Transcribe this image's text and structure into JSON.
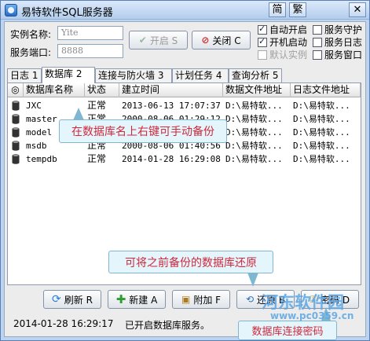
{
  "window": {
    "title": "易特软件SQL服务器",
    "btn_simplified": "简",
    "btn_traditional": "繁",
    "btn_close": "✕"
  },
  "form": {
    "instance_label": "实例名称:",
    "instance_value": "Yite",
    "port_label": "服务端口:",
    "port_value": "8888"
  },
  "buttons": {
    "start": "开启 S",
    "stop": "关闭 C"
  },
  "options": [
    {
      "label": "自动开启",
      "checked": true,
      "enabled": true
    },
    {
      "label": "服务守护",
      "checked": false,
      "enabled": true
    },
    {
      "label": "开机启动",
      "checked": true,
      "enabled": true
    },
    {
      "label": "服务日志",
      "checked": false,
      "enabled": true
    },
    {
      "label": "默认实例",
      "checked": false,
      "enabled": false
    },
    {
      "label": "服务窗口",
      "checked": false,
      "enabled": true
    }
  ],
  "tabs": [
    "日志 1",
    "数据库 2",
    "连接与防火墙 3",
    "计划任务 4",
    "查询分析 5"
  ],
  "active_tab": 1,
  "grid": {
    "headers": [
      "◎",
      "数据库名称",
      "状态",
      "建立时间",
      "数据文件地址",
      "日志文件地址"
    ],
    "rows": [
      {
        "name": "JXC",
        "status": "正常",
        "created": "2013-06-13 17:07:37",
        "data": "D:\\易特软...",
        "log": "D:\\易特软..."
      },
      {
        "name": "master",
        "status": "正常",
        "created": "2000-08-06 01:29:12",
        "data": "D:\\易特软...",
        "log": "D:\\易特软..."
      },
      {
        "name": "model",
        "status": "正常",
        "created": "2000-08-06 01:40:52",
        "data": "D:\\易特软...",
        "log": "D:\\易特软..."
      },
      {
        "name": "msdb",
        "status": "正常",
        "created": "2000-08-06 01:40:56",
        "data": "D:\\易特软...",
        "log": "D:\\易特软..."
      },
      {
        "name": "tempdb",
        "status": "正常",
        "created": "2014-01-28 16:29:08",
        "data": "D:\\易特软...",
        "log": "D:\\易特软..."
      }
    ]
  },
  "annotations": {
    "backup_hint": "在数据库名上右键可手动备份",
    "restore_hint": "可将之前备份的数据库还原",
    "password_hint": "数据库连接密码"
  },
  "toolbar": {
    "refresh": "刷新 R",
    "new": "新建 A",
    "attach": "附加 F",
    "restore": "还原 B",
    "password": "密码 D"
  },
  "status": {
    "time": "2014-01-28 16:29:17",
    "message": "已开启数据库服务。"
  },
  "watermark": {
    "line1": "河东软件园",
    "line2": "www.pc0359.cn"
  }
}
